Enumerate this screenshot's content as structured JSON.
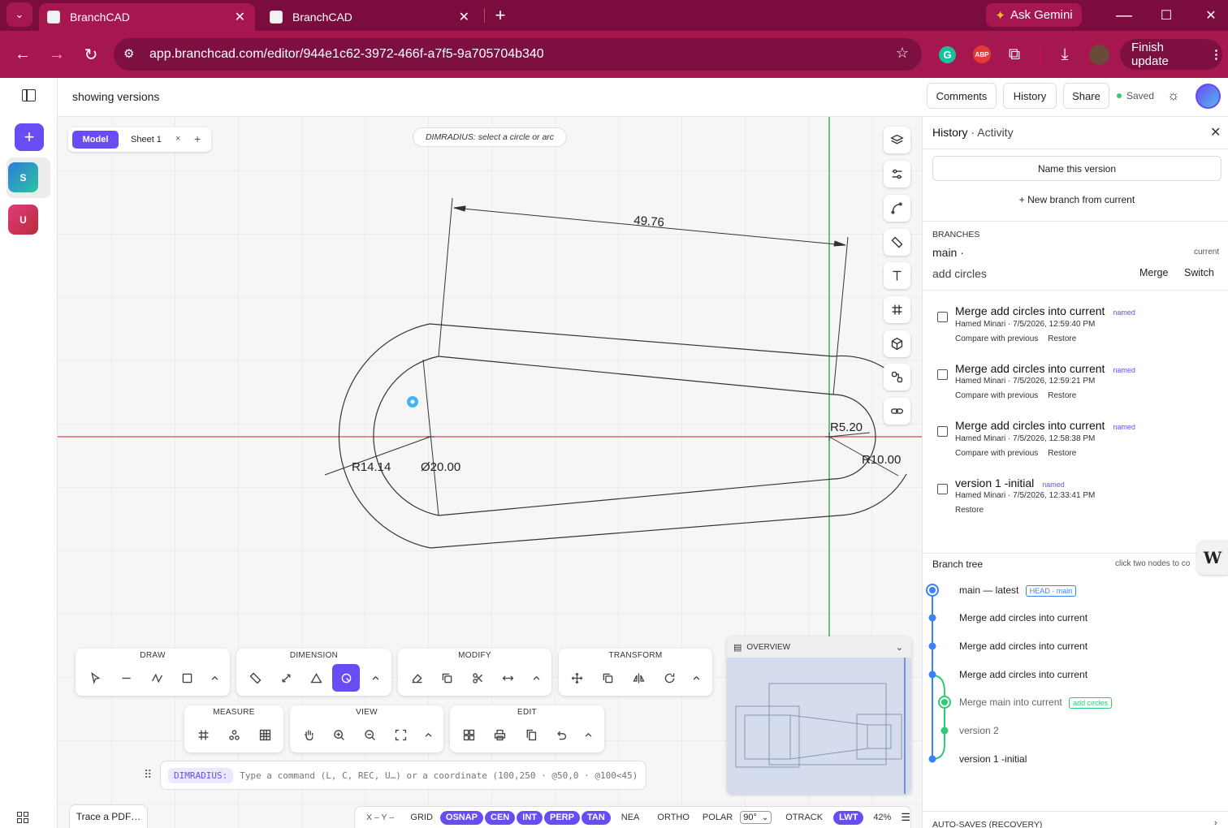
{
  "browser": {
    "tabs": [
      {
        "title": "BranchCAD",
        "active": true
      },
      {
        "title": "BranchCAD",
        "active": false
      }
    ],
    "url": "app.branchcad.com/editor/944e1c62-3972-466f-a7f5-9a705704b340",
    "gemini_label": "Ask Gemini",
    "abp_label": "ABP",
    "finish_update_label": "Finish update"
  },
  "leftrail": {
    "add_label": "+",
    "users": [
      {
        "initial": "S",
        "color": "#2ba9a0"
      },
      {
        "initial": "U",
        "color": "#c8295e"
      }
    ]
  },
  "topbar": {
    "title": "showing versions",
    "comments_label": "Comments",
    "history_label": "History",
    "share_label": "Share",
    "status": "Saved"
  },
  "sheet_tabs": {
    "model_label": "Model",
    "sheet_label": "Sheet 1",
    "close_label": "×",
    "add_label": "+"
  },
  "command_hint": "DIMRADIUS: select a circle or arc",
  "drawing": {
    "dim_top": "49.76",
    "dim_r_large": "R14.14",
    "dim_dia": "Ø20.00",
    "dim_r_small": "R5.20",
    "dim_r_right": "R10.00"
  },
  "toolbars": {
    "draw": "DRAW",
    "dimension": "DIMENSION",
    "modify": "MODIFY",
    "transform": "TRANSFORM",
    "measure": "MEASURE",
    "view": "VIEW",
    "edit": "EDIT"
  },
  "command_line": {
    "prefix": "DIMRADIUS:",
    "placeholder": "Type a command (L, C, REC, U…) or a coordinate (100,250 · @50,0 · @100<45)"
  },
  "overview": {
    "title": "OVERVIEW"
  },
  "trace_label": "Trace a PDF…",
  "statusbar": {
    "coords": "X –  Y –",
    "grid": "GRID",
    "toggles": [
      {
        "label": "OSNAP",
        "on": true
      },
      {
        "label": "CEN",
        "on": true
      },
      {
        "label": "INT",
        "on": true
      },
      {
        "label": "PERP",
        "on": true
      },
      {
        "label": "TAN",
        "on": true
      },
      {
        "label": "NEA",
        "on": false
      },
      {
        "label": "ORTHO",
        "on": false
      },
      {
        "label": "POLAR",
        "on": false
      }
    ],
    "polar_angle": "90°",
    "otrack": "OTRACK",
    "lwt": "LWT",
    "zoom": "42%"
  },
  "history_panel": {
    "title": "History",
    "subtitle": "· Activity",
    "name_version_label": "Name this version",
    "new_branch_label": "+ New branch from current",
    "branches_heading": "BRANCHES",
    "current_branch": "main ·",
    "current_tag": "current",
    "other_branch": "add circles",
    "merge_label": "Merge",
    "switch_label": "Switch",
    "versions": [
      {
        "title": "Merge add circles into current",
        "tag": "named",
        "meta": "Hamed Minari · 7/5/2026, 12:59:40 PM",
        "compare": "Compare with previous",
        "restore": "Restore"
      },
      {
        "title": "Merge add circles into current",
        "tag": "named",
        "meta": "Hamed Minari · 7/5/2026, 12:59:21 PM",
        "compare": "Compare with previous",
        "restore": "Restore"
      },
      {
        "title": "Merge add circles into current",
        "tag": "named",
        "meta": "Hamed Minari · 7/5/2026, 12:58:38 PM",
        "compare": "Compare with previous",
        "restore": "Restore"
      },
      {
        "title": "version 1 -initial",
        "tag": "named",
        "meta": "Hamed Minari · 7/5/2026, 12:33:41 PM",
        "compare": "",
        "restore": "Restore"
      }
    ],
    "tree_heading": "Branch tree",
    "tree_hint": "click two nodes to co",
    "tree_nodes": [
      {
        "label": "main — latest",
        "badge": "HEAD · main"
      },
      {
        "label": "Merge add circles into current",
        "badge": ""
      },
      {
        "label": "Merge add circles into current",
        "badge": ""
      },
      {
        "label": "Merge add circles into current",
        "badge": ""
      },
      {
        "label": "Merge main into current",
        "badge": "add circles"
      },
      {
        "label": "version 2",
        "badge": ""
      },
      {
        "label": "version 1 -initial",
        "badge": ""
      }
    ],
    "autosaves_label": "AUTO-SAVES (RECOVERY)"
  },
  "colors": {
    "browser_dark": "#7a0c3e",
    "browser_mid": "#a6174f",
    "accent": "#6a4cf5",
    "blue_node": "#3b82f6",
    "green_node": "#2ecc71",
    "saved_dot": "#2ecc71"
  }
}
